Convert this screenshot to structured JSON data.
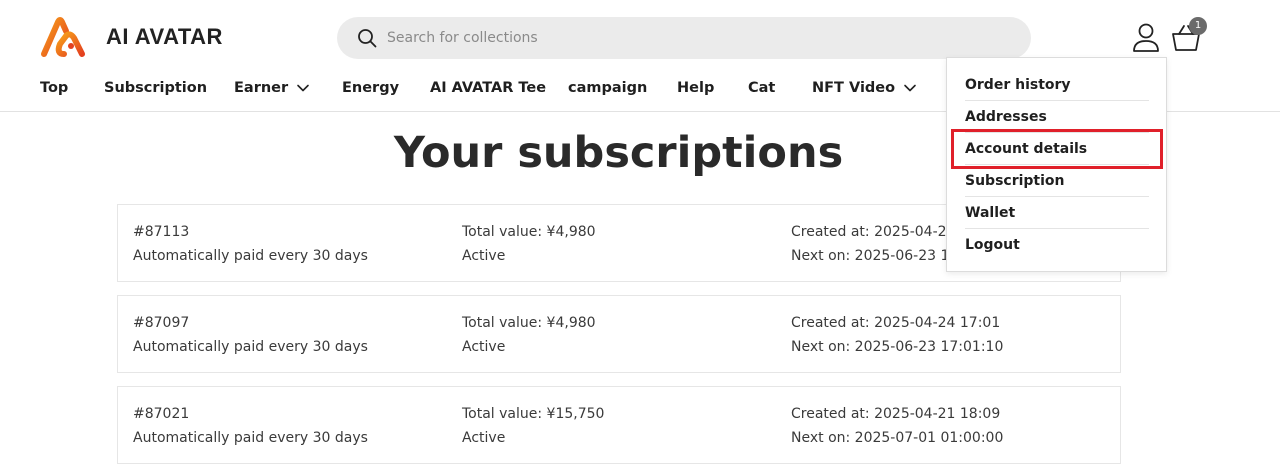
{
  "brand": {
    "name": "AI AVATAR",
    "colors": {
      "logo_gradient_start": "#f7a21b",
      "logo_gradient_end": "#e4411f",
      "highlight": "#e0202a"
    }
  },
  "search": {
    "placeholder": "Search for collections",
    "value": ""
  },
  "header": {
    "cart_count": "1",
    "account_icon": "user-icon",
    "cart_icon": "basket-icon"
  },
  "nav": {
    "items": [
      {
        "label": "Top",
        "has_dropdown": false
      },
      {
        "label": "Subscription",
        "has_dropdown": false
      },
      {
        "label": "Earner",
        "has_dropdown": true
      },
      {
        "label": "Energy",
        "has_dropdown": false
      },
      {
        "label": "AI AVATAR Tee",
        "has_dropdown": false
      },
      {
        "label": "campaign",
        "has_dropdown": false
      },
      {
        "label": "Help",
        "has_dropdown": false
      },
      {
        "label": "Cat",
        "has_dropdown": false
      },
      {
        "label": "NFT Video",
        "has_dropdown": true
      }
    ]
  },
  "main": {
    "title": "Your subscriptions"
  },
  "subscriptions": [
    {
      "id": "#87113",
      "schedule": "Automatically paid every 30 days",
      "total": "Total value: ¥4,980",
      "status": "Active",
      "created": "Created at: 2025-04-2",
      "next": "Next on: 2025-06-23 1"
    },
    {
      "id": "#87097",
      "schedule": "Automatically paid every 30 days",
      "total": "Total value: ¥4,980",
      "status": "Active",
      "created": "Created at: 2025-04-24 17:01",
      "next": "Next on: 2025-06-23 17:01:10"
    },
    {
      "id": "#87021",
      "schedule": "Automatically paid every 30 days",
      "total": "Total value: ¥15,750",
      "status": "Active",
      "created": "Created at: 2025-04-21 18:09",
      "next": "Next on: 2025-07-01 01:00:00"
    }
  ],
  "account_menu": {
    "items": [
      {
        "label": "Order history"
      },
      {
        "label": "Addresses"
      },
      {
        "label": "Account details",
        "highlighted": true
      },
      {
        "label": "Subscription"
      },
      {
        "label": "Wallet"
      },
      {
        "label": "Logout"
      }
    ]
  }
}
